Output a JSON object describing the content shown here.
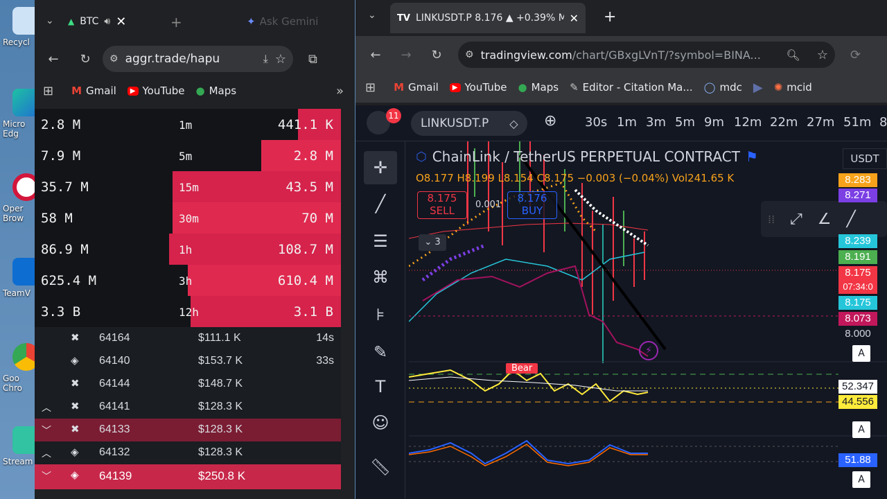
{
  "desktop": {
    "icons": [
      {
        "label": "Recycl",
        "icon": "recycle-bin-icon"
      },
      {
        "label": "Micro Edg",
        "icon": "edge-icon"
      },
      {
        "label": "Oper Brow",
        "icon": "opera-icon"
      },
      {
        "label": "TeamV",
        "icon": "teamviewer-icon"
      },
      {
        "label": "Goo Chro",
        "icon": "chrome-icon"
      },
      {
        "label": "Stream",
        "icon": "streamlabs-icon"
      }
    ]
  },
  "left_browser": {
    "tab_title": "BTC",
    "ask_gemini": "Ask Gemini",
    "url": "aggr.trade/hapu",
    "bookmarks": [
      "Gmail",
      "YouTube",
      "Maps"
    ],
    "stats": [
      {
        "left": "2.8 M",
        "tf": "1m",
        "right": "441.1 K",
        "fill": 0.14
      },
      {
        "left": "7.9 M",
        "tf": "5m",
        "right": "2.8 M",
        "fill": 0.26
      },
      {
        "left": "35.7 M",
        "tf": "15m",
        "right": "43.5 M",
        "fill": 0.55
      },
      {
        "left": "58 M",
        "tf": "30m",
        "right": "70 M",
        "fill": 0.55
      },
      {
        "left": "86.9 M",
        "tf": "1h",
        "right": "108.7 M",
        "fill": 0.56
      },
      {
        "left": "625.4 M",
        "tf": "3h",
        "right": "610.4 M",
        "fill": 0.5
      },
      {
        "left": "3.3 B",
        "tf": "12h",
        "right": "3.1 B",
        "fill": 0.49
      }
    ],
    "trades": [
      {
        "arrow": "",
        "price": "64164",
        "amount": "$111.1 K",
        "age": "14s",
        "style": ""
      },
      {
        "arrow": "",
        "price": "64140",
        "amount": "$153.7 K",
        "age": "33s",
        "style": ""
      },
      {
        "arrow": "",
        "price": "64144",
        "amount": "$148.7 K",
        "age": "",
        "style": ""
      },
      {
        "arrow": "^",
        "price": "64141",
        "amount": "$128.3 K",
        "age": "",
        "style": ""
      },
      {
        "arrow": "v",
        "price": "64133",
        "amount": "$128.3 K",
        "age": "",
        "style": "hl1"
      },
      {
        "arrow": "^",
        "price": "64132",
        "amount": "$128.3 K",
        "age": "",
        "style": ""
      },
      {
        "arrow": "v",
        "price": "64139",
        "amount": "$250.8 K",
        "age": "",
        "style": "hl2"
      }
    ]
  },
  "right_browser": {
    "tab_title": "LINKUSDT.P 8.176 ▲ +0.39% M",
    "url_domain": "tradingview.com",
    "url_rest": "/chart/GBxgLVnT/?symbol=BINA...",
    "bookmarks": [
      "Gmail",
      "YouTube",
      "Maps",
      "Editor - Citation Ma...",
      "mdc",
      "mcid"
    ],
    "tv": {
      "badge": "11",
      "symbol": "LINKUSDT.P",
      "timeframes": [
        "30s",
        "1m",
        "3m",
        "5m",
        "9m",
        "12m",
        "22m",
        "27m",
        "51m",
        "8"
      ],
      "title": "ChainLink / TetherUS PERPETUAL CONTRACT",
      "ohlc": "O8.177 H8.199 L8.154 C8.175 −0.003 (−0.04%) Vol241.65 K",
      "sell_price": "8.175",
      "sell_label": "SELL",
      "spread": "0.001",
      "buy_price": "8.176",
      "buy_label": "BUY",
      "count": "3",
      "currency": "USDT",
      "bear_label": "Bear",
      "price_tags": [
        {
          "v": "8.283",
          "color": "#f7a21b"
        },
        {
          "v": "8.271",
          "color": "#7b3fe4"
        },
        {
          "v": "8.239",
          "color": "#26c6da"
        },
        {
          "v": "8.191",
          "color": "#4caf50"
        },
        {
          "v": "8.175",
          "color": "#f23645"
        },
        {
          "v": "07:34:0",
          "color": "#f23645"
        },
        {
          "v": "8.175",
          "color": "#26c6da"
        },
        {
          "v": "8.073",
          "color": "#c2185b"
        },
        {
          "v": "8.000",
          "color": "#131722"
        },
        {
          "v": "52.347",
          "color": "#ffffff"
        },
        {
          "v": "44.556",
          "color": "#ffeb3b"
        },
        {
          "v": "51.88",
          "color": "#2962ff"
        }
      ]
    }
  }
}
